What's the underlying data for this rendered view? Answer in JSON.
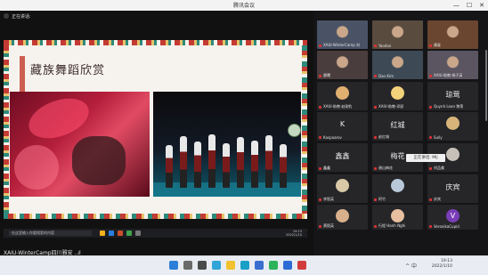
{
  "window": {
    "title": "腾讯会议"
  },
  "share": {
    "status": "正在讲话:",
    "slide_title": "藏族舞蹈欣赏",
    "inner_taskbar": {
      "search_placeholder": "在这里输入你要搜索的内容",
      "clock_time": "19:13",
      "clock_date": "2022/1/10"
    }
  },
  "bottom_title": "XAIU-WinterCamp四川雅安 ..ıl",
  "participants": [
    {
      "name": "XAIU-WinterCamp 刘",
      "type": "video",
      "color": "#4a5266"
    },
    {
      "name": "Yaodan",
      "type": "video",
      "color": "#5a4b3f"
    },
    {
      "name": "康复",
      "type": "video",
      "color": "#6a4530"
    },
    {
      "name": "晨曦",
      "type": "video",
      "color": "#4a3d3d"
    },
    {
      "name": "Dan Kim",
      "type": "video",
      "color": "#3d4a55"
    },
    {
      "name": "XAIU-助教-杨子英",
      "type": "video",
      "color": "#5a5560"
    },
    {
      "name": "XAIU-助教-赵刚钧",
      "type": "avatar",
      "color": "#e0b070"
    },
    {
      "name": "XAIU-助教-邓跃",
      "type": "avatar",
      "color": "#f2d27a"
    },
    {
      "name": "Quynh Loan 黎荣",
      "type": "text",
      "big": "琼莺"
    },
    {
      "name": "Kaspaarov",
      "type": "text",
      "big": "K"
    },
    {
      "name": "赵红城",
      "type": "text",
      "big": "红城"
    },
    {
      "name": "Sully",
      "type": "avatar",
      "color": "#d8b47a"
    },
    {
      "name": "鑫鑫",
      "type": "text",
      "big": "鑫鑫"
    },
    {
      "name": "谢山梅花",
      "type": "text",
      "big": "梅花"
    },
    {
      "name": "刘品美",
      "type": "avatar",
      "color": "#c7c0b8"
    },
    {
      "name": "李智英",
      "type": "avatar",
      "color": "#d9c9a6"
    },
    {
      "name": "阿竹",
      "type": "avatar",
      "color": "#b8c8d8"
    },
    {
      "name": "庆宾",
      "type": "text",
      "big": "庆宾"
    },
    {
      "name": "黄毅英",
      "type": "avatar",
      "color": "#d9b08c"
    },
    {
      "name": "行程 Hanh Nghi",
      "type": "avatar",
      "color": "#e8c0a0"
    },
    {
      "name": "VeronikaCupid",
      "type": "letter",
      "big": "V",
      "color": "#7a3db8"
    }
  ],
  "tooltip": "正在讲话: Mlj",
  "taskbar": {
    "time": "19:13",
    "date": "2022/1/10",
    "tray": "^ 中"
  },
  "colors": {
    "slide_border": "#4a1016",
    "accent_red": "#c43b33",
    "accent_teal": "#2e8a7a",
    "accent_gold": "#e7c36a"
  }
}
